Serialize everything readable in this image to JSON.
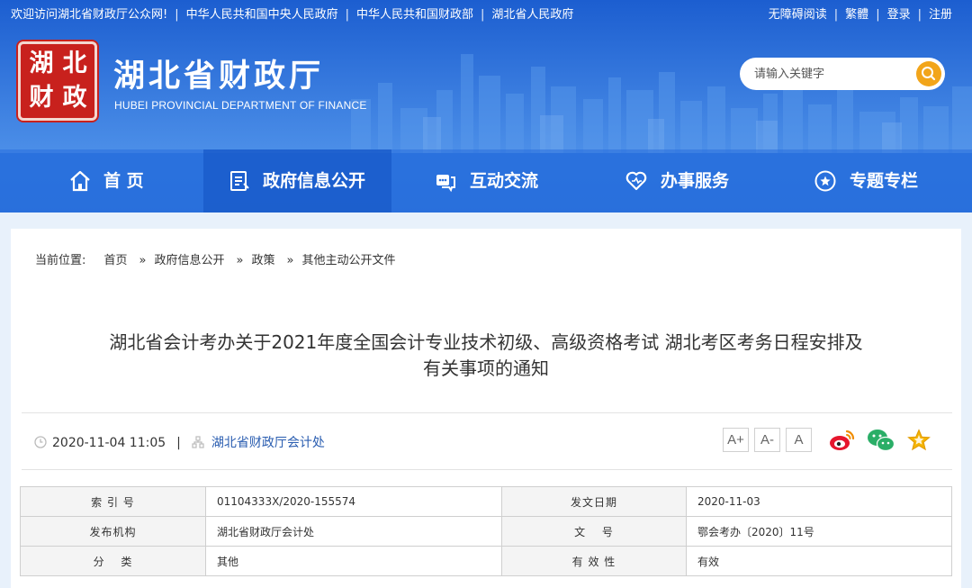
{
  "topbar": {
    "left_links": [
      "欢迎访问湖北省财政厅公众网!",
      "中华人民共和国中央人民政府",
      "中华人民共和国财政部",
      "湖北省人民政府"
    ],
    "right_links": [
      "无障碍阅读",
      "繁體",
      "登录",
      "注册"
    ]
  },
  "logo": {
    "seal_chars": [
      "湖",
      "北",
      "财",
      "政"
    ],
    "title": "湖北省财政厅",
    "subtitle": "HUBEI PROVINCIAL DEPARTMENT OF FINANCE"
  },
  "search": {
    "placeholder": "请输入关键字",
    "icon": "search-icon"
  },
  "nav": {
    "items": [
      {
        "label": "首 页",
        "icon": "home-icon"
      },
      {
        "label": "政府信息公开",
        "icon": "document-icon"
      },
      {
        "label": "互动交流",
        "icon": "chat-icon"
      },
      {
        "label": "办事服务",
        "icon": "heart-icon"
      },
      {
        "label": "专题专栏",
        "icon": "star-circle-icon"
      }
    ],
    "active_index": 1
  },
  "breadcrumb": {
    "prefix": "当前位置:",
    "items": [
      "首页",
      "政府信息公开",
      "政策",
      "其他主动公开文件"
    ],
    "separator": "»"
  },
  "article": {
    "title_line1": "湖北省会计考办关于2021年度全国会计专业技术初级、高级资格考试 湖北考区考务日程安排及",
    "title_line2": "有关事项的通知",
    "datetime": "2020-11-04 11:05",
    "divider": "|",
    "source": "湖北省财政厅会计处",
    "font_buttons": [
      "A+",
      "A-",
      "A"
    ],
    "share_icons": [
      "weibo-icon",
      "wechat-icon",
      "favorite-star-icon"
    ]
  },
  "info_table": {
    "rows": [
      {
        "k1": "索 引 号",
        "v1": "01104333X/2020-155574",
        "k2": "发文日期",
        "v2": "2020-11-03"
      },
      {
        "k1": "发布机构",
        "v1": "湖北省财政厅会计处",
        "k2": "文　 号",
        "v2": "鄂会考办〔2020〕11号"
      },
      {
        "k1": "分　 类",
        "v1": "其他",
        "k2": "有 效 性",
        "v2": "有效"
      }
    ]
  },
  "colors": {
    "header_blue": "#2c6fdc",
    "nav_active": "#1a5cc8",
    "seal_red": "#c8211d",
    "search_button": "#f2a51a",
    "page_bg": "#e8f1fb",
    "link_blue": "#2a5db0"
  }
}
